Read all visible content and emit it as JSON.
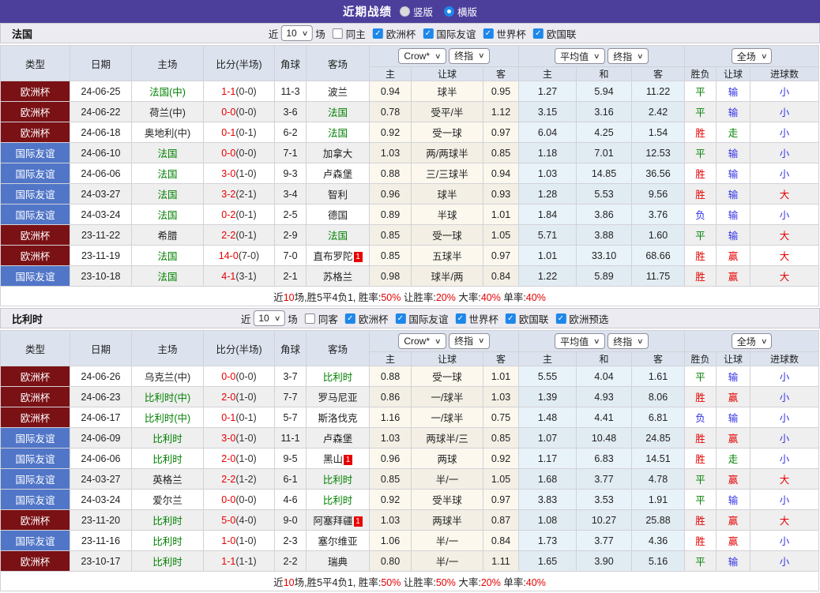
{
  "colors": {
    "accent_purple": "#4c3f9c",
    "league_euro_bg": "#7a1115",
    "league_friendly_bg": "#5176c8",
    "focal_team_green": "#008000",
    "win_red": "#e60000",
    "loss_blue": "#3333e6",
    "checkbox_blue": "#1e87ea",
    "odds_cream_bg": "#fcf8ee",
    "avg_blue_bg": "#e8f2f9"
  },
  "title_bar": {
    "title": "近期战绩",
    "radios": [
      {
        "label": "竖版",
        "selected": false
      },
      {
        "label": "横版",
        "selected": true
      }
    ]
  },
  "filter_labels": {
    "near": "近",
    "matches": "场"
  },
  "table_header": {
    "static": [
      "类型",
      "日期",
      "主场",
      "比分(半场)",
      "角球",
      "客场"
    ],
    "dropdown_groups": [
      [
        "Crow*",
        "终指"
      ],
      [
        "平均值",
        "终指"
      ],
      [
        "全场"
      ]
    ],
    "sub": [
      "主",
      "让球",
      "客",
      "主",
      "和",
      "客",
      "胜负",
      "让球",
      "进球数"
    ]
  },
  "sections": [
    {
      "team": "法国",
      "near_value": "10",
      "same_side_label": "同主",
      "same_side_checked": false,
      "leagues": [
        "欧洲杯",
        "国际友谊",
        "世界杯",
        "欧国联"
      ],
      "rows": [
        {
          "league": "欧洲杯",
          "date": "24-06-25",
          "home": "法国(中)",
          "home_focal": true,
          "home_card": "",
          "score": "1-1",
          "half": "(0-0)",
          "corners": "11-3",
          "away": "波兰",
          "away_focal": false,
          "away_card": "",
          "odds": [
            "0.94",
            "球半",
            "0.95"
          ],
          "avg": [
            "1.27",
            "5.94",
            "11.22"
          ],
          "results": [
            "平",
            "输",
            "小"
          ]
        },
        {
          "league": "欧洲杯",
          "date": "24-06-22",
          "home": "荷兰(中)",
          "home_focal": false,
          "home_card": "",
          "score": "0-0",
          "half": "(0-0)",
          "corners": "3-6",
          "away": "法国",
          "away_focal": true,
          "away_card": "",
          "odds": [
            "0.78",
            "受平/半",
            "1.12"
          ],
          "avg": [
            "3.15",
            "3.16",
            "2.42"
          ],
          "results": [
            "平",
            "输",
            "小"
          ]
        },
        {
          "league": "欧洲杯",
          "date": "24-06-18",
          "home": "奥地利(中)",
          "home_focal": false,
          "home_card": "",
          "score": "0-1",
          "half": "(0-1)",
          "corners": "6-2",
          "away": "法国",
          "away_focal": true,
          "away_card": "",
          "odds": [
            "0.92",
            "受一球",
            "0.97"
          ],
          "avg": [
            "6.04",
            "4.25",
            "1.54"
          ],
          "results": [
            "胜",
            "走",
            "小"
          ]
        },
        {
          "league": "国际友谊",
          "date": "24-06-10",
          "home": "法国",
          "home_focal": true,
          "home_card": "",
          "score": "0-0",
          "half": "(0-0)",
          "corners": "7-1",
          "away": "加拿大",
          "away_focal": false,
          "away_card": "",
          "odds": [
            "1.03",
            "两/两球半",
            "0.85"
          ],
          "avg": [
            "1.18",
            "7.01",
            "12.53"
          ],
          "results": [
            "平",
            "输",
            "小"
          ]
        },
        {
          "league": "国际友谊",
          "date": "24-06-06",
          "home": "法国",
          "home_focal": true,
          "home_card": "",
          "score": "3-0",
          "half": "(1-0)",
          "corners": "9-3",
          "away": "卢森堡",
          "away_focal": false,
          "away_card": "",
          "odds": [
            "0.88",
            "三/三球半",
            "0.94"
          ],
          "avg": [
            "1.03",
            "14.85",
            "36.56"
          ],
          "results": [
            "胜",
            "输",
            "小"
          ]
        },
        {
          "league": "国际友谊",
          "date": "24-03-27",
          "home": "法国",
          "home_focal": true,
          "home_card": "",
          "score": "3-2",
          "half": "(2-1)",
          "corners": "3-4",
          "away": "智利",
          "away_focal": false,
          "away_card": "",
          "odds": [
            "0.96",
            "球半",
            "0.93"
          ],
          "avg": [
            "1.28",
            "5.53",
            "9.56"
          ],
          "results": [
            "胜",
            "输",
            "大"
          ]
        },
        {
          "league": "国际友谊",
          "date": "24-03-24",
          "home": "法国",
          "home_focal": true,
          "home_card": "",
          "score": "0-2",
          "half": "(0-1)",
          "corners": "2-5",
          "away": "德国",
          "away_focal": false,
          "away_card": "",
          "odds": [
            "0.89",
            "半球",
            "1.01"
          ],
          "avg": [
            "1.84",
            "3.86",
            "3.76"
          ],
          "results": [
            "负",
            "输",
            "小"
          ]
        },
        {
          "league": "欧洲杯",
          "date": "23-11-22",
          "home": "希腊",
          "home_focal": false,
          "home_card": "",
          "score": "2-2",
          "half": "(0-1)",
          "corners": "2-9",
          "away": "法国",
          "away_focal": true,
          "away_card": "",
          "odds": [
            "0.85",
            "受一球",
            "1.05"
          ],
          "avg": [
            "5.71",
            "3.88",
            "1.60"
          ],
          "results": [
            "平",
            "输",
            "大"
          ]
        },
        {
          "league": "欧洲杯",
          "date": "23-11-19",
          "home": "法国",
          "home_focal": true,
          "home_card": "",
          "score": "14-0",
          "half": "(7-0)",
          "corners": "7-0",
          "away": "直布罗陀",
          "away_focal": false,
          "away_card": "1",
          "odds": [
            "0.85",
            "五球半",
            "0.97"
          ],
          "avg": [
            "1.01",
            "33.10",
            "68.66"
          ],
          "results": [
            "胜",
            "赢",
            "大"
          ]
        },
        {
          "league": "国际友谊",
          "date": "23-10-18",
          "home": "法国",
          "home_focal": true,
          "home_card": "",
          "score": "4-1",
          "half": "(3-1)",
          "corners": "2-1",
          "away": "苏格兰",
          "away_focal": false,
          "away_card": "",
          "odds": [
            "0.98",
            "球半/两",
            "0.84"
          ],
          "avg": [
            "1.22",
            "5.89",
            "11.75"
          ],
          "results": [
            "胜",
            "赢",
            "大"
          ]
        }
      ],
      "summary": [
        {
          "text": "近",
          "red": false
        },
        {
          "text": "10",
          "red": true
        },
        {
          "text": "场,胜5平4负1, 胜率:",
          "red": false
        },
        {
          "text": "50%",
          "red": true
        },
        {
          "text": " 让胜率:",
          "red": false
        },
        {
          "text": "20%",
          "red": true
        },
        {
          "text": " 大率:",
          "red": false
        },
        {
          "text": "40%",
          "red": true
        },
        {
          "text": " 单率:",
          "red": false
        },
        {
          "text": "40%",
          "red": true
        }
      ]
    },
    {
      "team": "比利时",
      "near_value": "10",
      "same_side_label": "同客",
      "same_side_checked": false,
      "leagues": [
        "欧洲杯",
        "国际友谊",
        "世界杯",
        "欧国联",
        "欧洲预选"
      ],
      "rows": [
        {
          "league": "欧洲杯",
          "date": "24-06-26",
          "home": "乌克兰(中)",
          "home_focal": false,
          "home_card": "",
          "score": "0-0",
          "half": "(0-0)",
          "corners": "3-7",
          "away": "比利时",
          "away_focal": true,
          "away_card": "",
          "odds": [
            "0.88",
            "受一球",
            "1.01"
          ],
          "avg": [
            "5.55",
            "4.04",
            "1.61"
          ],
          "results": [
            "平",
            "输",
            "小"
          ]
        },
        {
          "league": "欧洲杯",
          "date": "24-06-23",
          "home": "比利时(中)",
          "home_focal": true,
          "home_card": "",
          "score": "2-0",
          "half": "(1-0)",
          "corners": "7-7",
          "away": "罗马尼亚",
          "away_focal": false,
          "away_card": "",
          "odds": [
            "0.86",
            "一/球半",
            "1.03"
          ],
          "avg": [
            "1.39",
            "4.93",
            "8.06"
          ],
          "results": [
            "胜",
            "赢",
            "小"
          ]
        },
        {
          "league": "欧洲杯",
          "date": "24-06-17",
          "home": "比利时(中)",
          "home_focal": true,
          "home_card": "",
          "score": "0-1",
          "half": "(0-1)",
          "corners": "5-7",
          "away": "斯洛伐克",
          "away_focal": false,
          "away_card": "",
          "odds": [
            "1.16",
            "一/球半",
            "0.75"
          ],
          "avg": [
            "1.48",
            "4.41",
            "6.81"
          ],
          "results": [
            "负",
            "输",
            "小"
          ]
        },
        {
          "league": "国际友谊",
          "date": "24-06-09",
          "home": "比利时",
          "home_focal": true,
          "home_card": "",
          "score": "3-0",
          "half": "(1-0)",
          "corners": "11-1",
          "away": "卢森堡",
          "away_focal": false,
          "away_card": "",
          "odds": [
            "1.03",
            "两球半/三",
            "0.85"
          ],
          "avg": [
            "1.07",
            "10.48",
            "24.85"
          ],
          "results": [
            "胜",
            "赢",
            "小"
          ]
        },
        {
          "league": "国际友谊",
          "date": "24-06-06",
          "home": "比利时",
          "home_focal": true,
          "home_card": "",
          "score": "2-0",
          "half": "(1-0)",
          "corners": "9-5",
          "away": "黑山",
          "away_focal": false,
          "away_card": "1",
          "odds": [
            "0.96",
            "两球",
            "0.92"
          ],
          "avg": [
            "1.17",
            "6.83",
            "14.51"
          ],
          "results": [
            "胜",
            "走",
            "小"
          ]
        },
        {
          "league": "国际友谊",
          "date": "24-03-27",
          "home": "英格兰",
          "home_focal": false,
          "home_card": "",
          "score": "2-2",
          "half": "(1-2)",
          "corners": "6-1",
          "away": "比利时",
          "away_focal": true,
          "away_card": "",
          "odds": [
            "0.85",
            "半/一",
            "1.05"
          ],
          "avg": [
            "1.68",
            "3.77",
            "4.78"
          ],
          "results": [
            "平",
            "赢",
            "大"
          ]
        },
        {
          "league": "国际友谊",
          "date": "24-03-24",
          "home": "爱尔兰",
          "home_focal": false,
          "home_card": "",
          "score": "0-0",
          "half": "(0-0)",
          "corners": "4-6",
          "away": "比利时",
          "away_focal": true,
          "away_card": "",
          "odds": [
            "0.92",
            "受半球",
            "0.97"
          ],
          "avg": [
            "3.83",
            "3.53",
            "1.91"
          ],
          "results": [
            "平",
            "输",
            "小"
          ]
        },
        {
          "league": "欧洲杯",
          "date": "23-11-20",
          "home": "比利时",
          "home_focal": true,
          "home_card": "",
          "score": "5-0",
          "half": "(4-0)",
          "corners": "9-0",
          "away": "阿塞拜疆",
          "away_focal": false,
          "away_card": "1",
          "odds": [
            "1.03",
            "两球半",
            "0.87"
          ],
          "avg": [
            "1.08",
            "10.27",
            "25.88"
          ],
          "results": [
            "胜",
            "赢",
            "大"
          ]
        },
        {
          "league": "国际友谊",
          "date": "23-11-16",
          "home": "比利时",
          "home_focal": true,
          "home_card": "",
          "score": "1-0",
          "half": "(1-0)",
          "corners": "2-3",
          "away": "塞尔维亚",
          "away_focal": false,
          "away_card": "",
          "odds": [
            "1.06",
            "半/一",
            "0.84"
          ],
          "avg": [
            "1.73",
            "3.77",
            "4.36"
          ],
          "results": [
            "胜",
            "赢",
            "小"
          ]
        },
        {
          "league": "欧洲杯",
          "date": "23-10-17",
          "home": "比利时",
          "home_focal": true,
          "home_card": "",
          "score": "1-1",
          "half": "(1-1)",
          "corners": "2-2",
          "away": "瑞典",
          "away_focal": false,
          "away_card": "",
          "odds": [
            "0.80",
            "半/一",
            "1.11"
          ],
          "avg": [
            "1.65",
            "3.90",
            "5.16"
          ],
          "results": [
            "平",
            "输",
            "小"
          ]
        }
      ],
      "summary": [
        {
          "text": "近",
          "red": false
        },
        {
          "text": "10",
          "red": true
        },
        {
          "text": "场,胜5平4负1, 胜率:",
          "red": false
        },
        {
          "text": "50%",
          "red": true
        },
        {
          "text": " 让胜率:",
          "red": false
        },
        {
          "text": "50%",
          "red": true
        },
        {
          "text": " 大率:",
          "red": false
        },
        {
          "text": "20%",
          "red": true
        },
        {
          "text": " 单率:",
          "red": false
        },
        {
          "text": "40%",
          "red": true
        }
      ]
    }
  ]
}
